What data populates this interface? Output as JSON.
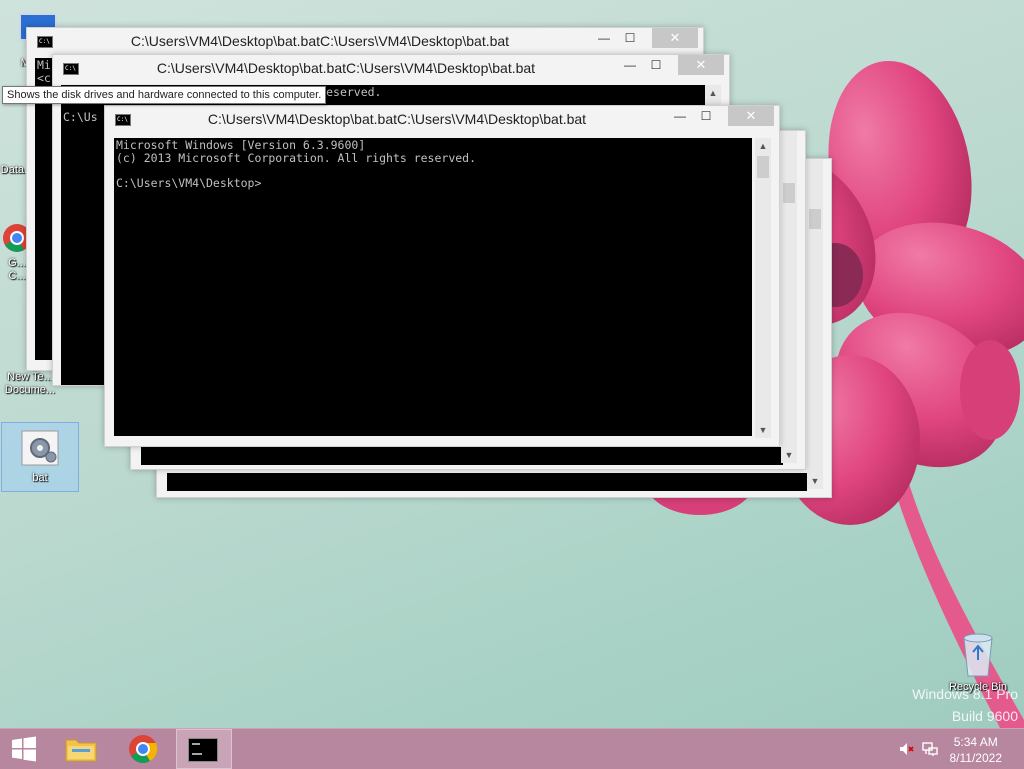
{
  "tooltip": "Shows the disk drives and hardware connected to this computer.",
  "desktop": {
    "icons": [
      {
        "label": "My C..."
      },
      {
        "label": "Data..."
      },
      {
        "label": "G... C..."
      },
      {
        "label": "New Te... Docume..."
      },
      {
        "label": "bat"
      },
      {
        "label": "Recycle Bin"
      }
    ]
  },
  "windows": [
    {
      "title": "C:\\Users\\VM4\\Desktop\\bat.batC:\\Users\\VM4\\Desktop\\bat.bat",
      "console_text": "Mi\n<c"
    },
    {
      "title": "C:\\Users\\VM4\\Desktop\\bat.batC:\\Users\\VM4\\Desktop\\bat.bat",
      "console_text": "                               ights reserved.\n\nC:\\Us"
    },
    {
      "title": "C:\\Users\\VM4\\Desktop\\bat.batC:\\Users\\VM4\\Desktop\\bat.bat",
      "console_text": "Microsoft Windows [Version 6.3.9600]\n(c) 2013 Microsoft Corporation. All rights reserved.\n\nC:\\Users\\VM4\\Desktop>"
    },
    {
      "title": "",
      "console_text": ""
    },
    {
      "title": "",
      "console_text": ""
    }
  ],
  "window_buttons": {
    "minimize": "—",
    "maximize": "☐",
    "close": "✕"
  },
  "watermark": {
    "line1": "Windows 8.1 Pro",
    "line2": "Build 9600"
  },
  "taskbar": {
    "clock_time": "5:34 AM",
    "clock_date": "8/11/2022"
  },
  "colors": {
    "taskbar": "#b7869f",
    "console_bg": "#000000",
    "console_fg": "#c0c0c0",
    "flower": "#e0457f"
  }
}
